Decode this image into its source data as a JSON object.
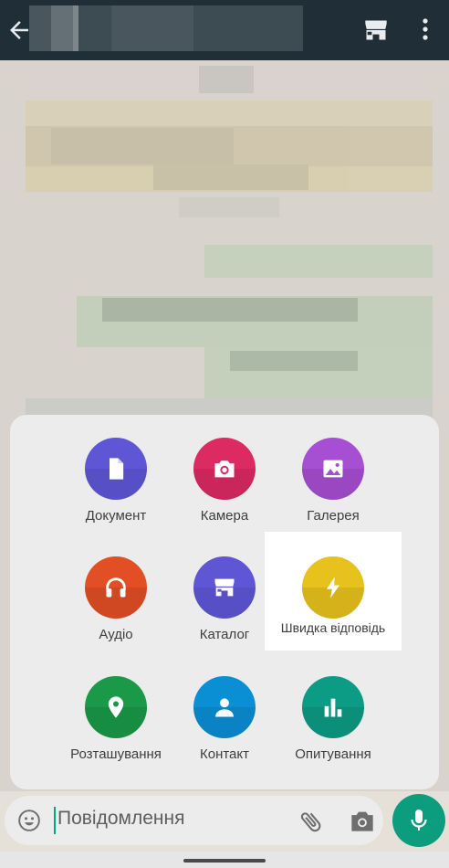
{
  "header": {
    "back_icon": "arrow-back-icon",
    "store_icon": "storefront-icon",
    "more_icon": "more-vert-icon",
    "background": "#1f2e37"
  },
  "attachments": {
    "items": [
      {
        "label": "Документ",
        "icon": "document-icon",
        "color": "#5f56d6"
      },
      {
        "label": "Камера",
        "icon": "camera-icon",
        "color": "#dc2a63"
      },
      {
        "label": "Галерея",
        "icon": "gallery-icon",
        "color": "#a74fd2"
      },
      {
        "label": "Аудіо",
        "icon": "headphones-icon",
        "color": "#e24f24"
      },
      {
        "label": "Каталог",
        "icon": "storefront-icon",
        "color": "#5f56d6"
      },
      {
        "label": "Швидка відповідь",
        "icon": "lightning-icon",
        "color": "#e8c21c"
      },
      {
        "label": "Розташування",
        "icon": "location-pin-icon",
        "color": "#1a9a48"
      },
      {
        "label": "Контакт",
        "icon": "person-icon",
        "color": "#0a8fd5"
      },
      {
        "label": "Опитування",
        "icon": "bar-chart-icon",
        "color": "#0c9c86"
      }
    ]
  },
  "input": {
    "placeholder": "Повідомлення",
    "emoji_icon": "emoji-icon",
    "attach_icon": "paperclip-icon",
    "camera_icon": "camera-icon",
    "mic_icon": "microphone-icon",
    "mic_color": "#0c9c7e"
  }
}
